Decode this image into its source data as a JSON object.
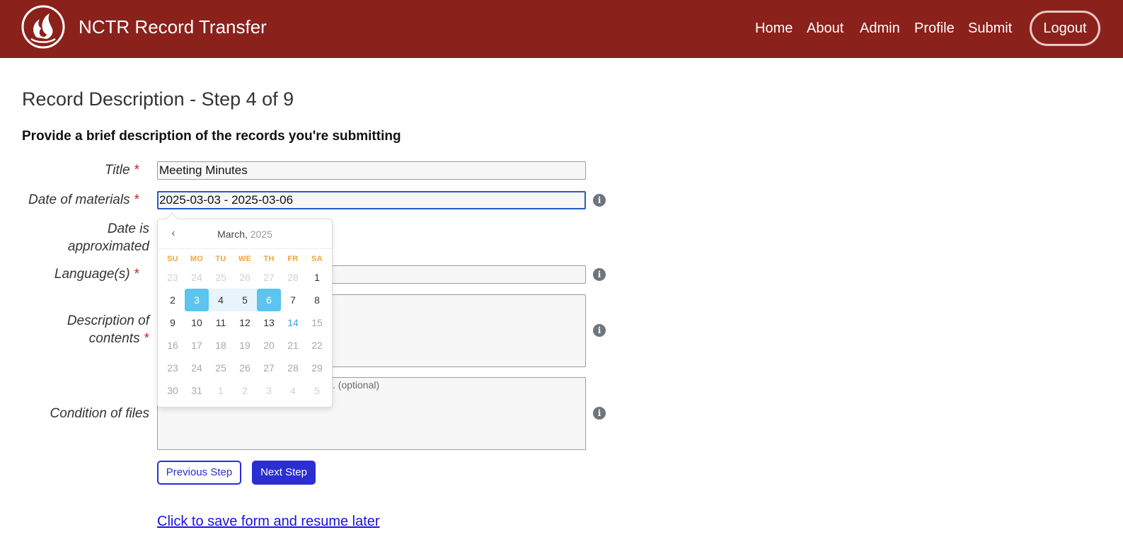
{
  "header": {
    "app_title": "NCTR Record Transfer",
    "nav": [
      "Home",
      "About",
      "Admin",
      "Profile",
      "Submit"
    ],
    "logout_label": "Logout",
    "brand_color": "#8b211b"
  },
  "page": {
    "title": "Record Description - Step 4 of 9",
    "subtitle": "Provide a brief description of the records you're submitting"
  },
  "form": {
    "required_mark": "*",
    "title_label": "Title",
    "title_value": "Meeting Minutes",
    "date_label": "Date of materials",
    "date_value": "2025-03-03 - 2025-03-06",
    "approx_label_line1": "Date is",
    "approx_label_line2": "approximated",
    "language_label": "Language(s)",
    "description_label_line1": "Description of",
    "description_label_line2": "contents",
    "condition_label": "Condition of files",
    "condition_placeholder_fragment": ". (optional)",
    "info_icon_glyph": "i"
  },
  "buttons": {
    "previous": "Previous Step",
    "next": "Next Step",
    "save_link": "Click to save form and resume later"
  },
  "datepicker": {
    "month": "March,",
    "year": "2025",
    "prev_glyph": "‹",
    "day_names": [
      "SU",
      "MO",
      "TU",
      "WE",
      "TH",
      "FR",
      "SA"
    ],
    "weeks": [
      [
        {
          "d": "23",
          "s": "other"
        },
        {
          "d": "24",
          "s": "other"
        },
        {
          "d": "25",
          "s": "other"
        },
        {
          "d": "26",
          "s": "other"
        },
        {
          "d": "27",
          "s": "other"
        },
        {
          "d": "28",
          "s": "other"
        },
        {
          "d": "1",
          "s": ""
        }
      ],
      [
        {
          "d": "2",
          "s": ""
        },
        {
          "d": "3",
          "s": "selected"
        },
        {
          "d": "4",
          "s": "range"
        },
        {
          "d": "5",
          "s": "range"
        },
        {
          "d": "6",
          "s": "selected"
        },
        {
          "d": "7",
          "s": ""
        },
        {
          "d": "8",
          "s": ""
        }
      ],
      [
        {
          "d": "9",
          "s": ""
        },
        {
          "d": "10",
          "s": ""
        },
        {
          "d": "11",
          "s": ""
        },
        {
          "d": "12",
          "s": ""
        },
        {
          "d": "13",
          "s": ""
        },
        {
          "d": "14",
          "s": "today"
        },
        {
          "d": "15",
          "s": "disabled"
        }
      ],
      [
        {
          "d": "16",
          "s": "disabled"
        },
        {
          "d": "17",
          "s": "disabled"
        },
        {
          "d": "18",
          "s": "disabled"
        },
        {
          "d": "19",
          "s": "disabled"
        },
        {
          "d": "20",
          "s": "disabled"
        },
        {
          "d": "21",
          "s": "disabled"
        },
        {
          "d": "22",
          "s": "disabled"
        }
      ],
      [
        {
          "d": "23",
          "s": "disabled"
        },
        {
          "d": "24",
          "s": "disabled"
        },
        {
          "d": "25",
          "s": "disabled"
        },
        {
          "d": "26",
          "s": "disabled"
        },
        {
          "d": "27",
          "s": "disabled"
        },
        {
          "d": "28",
          "s": "disabled"
        },
        {
          "d": "29",
          "s": "disabled"
        }
      ],
      [
        {
          "d": "30",
          "s": "disabled"
        },
        {
          "d": "31",
          "s": "disabled"
        },
        {
          "d": "1",
          "s": "other"
        },
        {
          "d": "2",
          "s": "other"
        },
        {
          "d": "3",
          "s": "other"
        },
        {
          "d": "4",
          "s": "other"
        },
        {
          "d": "5",
          "s": "other"
        }
      ]
    ]
  }
}
